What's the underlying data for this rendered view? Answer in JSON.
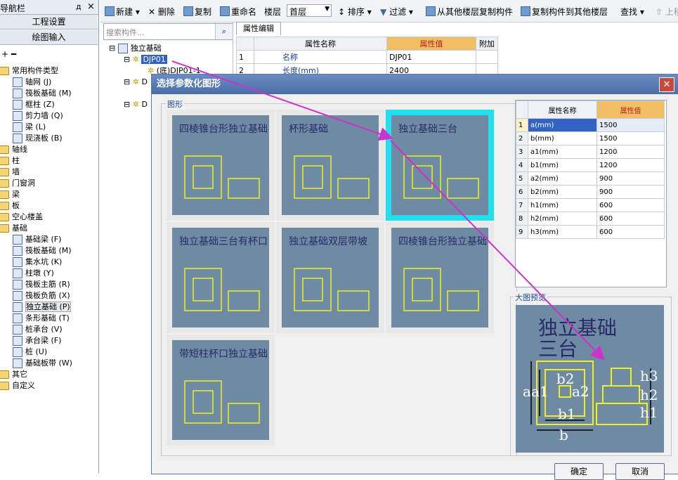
{
  "nav": {
    "title": "导航栏",
    "pin": "д",
    "close": "×",
    "btn_project": "工程设置",
    "btn_draw": "绘图输入",
    "tree": [
      {
        "label": "常用构件类型",
        "level": 0,
        "folder": true,
        "open": true
      },
      {
        "label": "轴网 (J)",
        "level": 1
      },
      {
        "label": "筏板基础 (M)",
        "level": 1
      },
      {
        "label": "框柱 (Z)",
        "level": 1
      },
      {
        "label": "剪力墙 (Q)",
        "level": 1
      },
      {
        "label": "梁 (L)",
        "level": 1
      },
      {
        "label": "现浇板 (B)",
        "level": 1
      },
      {
        "label": "轴线",
        "level": 0,
        "folder": true
      },
      {
        "label": "柱",
        "level": 0,
        "folder": true
      },
      {
        "label": "墙",
        "level": 0,
        "folder": true
      },
      {
        "label": "门窗洞",
        "level": 0,
        "folder": true
      },
      {
        "label": "梁",
        "level": 0,
        "folder": true
      },
      {
        "label": "板",
        "level": 0,
        "folder": true
      },
      {
        "label": "空心楼盖",
        "level": 0,
        "folder": true
      },
      {
        "label": "基础",
        "level": 0,
        "folder": true,
        "open": true
      },
      {
        "label": "基础梁 (F)",
        "level": 1
      },
      {
        "label": "筏板基础 (M)",
        "level": 1
      },
      {
        "label": "集水坑 (K)",
        "level": 1
      },
      {
        "label": "柱墩 (Y)",
        "level": 1
      },
      {
        "label": "筏板主筋 (R)",
        "level": 1
      },
      {
        "label": "筏板负筋 (X)",
        "level": 1
      },
      {
        "label": "独立基础 (P)",
        "level": 1,
        "selected": true
      },
      {
        "label": "条形基础 (T)",
        "level": 1
      },
      {
        "label": "桩承台 (V)",
        "level": 1
      },
      {
        "label": "承台梁 (F)",
        "level": 1
      },
      {
        "label": "桩 (U)",
        "level": 1
      },
      {
        "label": "基础板带 (W)",
        "level": 1
      },
      {
        "label": "其它",
        "level": 0,
        "folder": true
      },
      {
        "label": "自定义",
        "level": 0,
        "folder": true
      }
    ]
  },
  "toolbar": {
    "new": "新建",
    "delete": "删除",
    "copy": "复制",
    "rename": "重命名",
    "floor_label": "楼层",
    "floor_value": "首层",
    "sort": "排序",
    "filter": "过滤",
    "copy_from": "从其他楼层复制构件",
    "copy_to": "复制构件到其他楼层",
    "find": "查找",
    "more": "上移"
  },
  "search": {
    "placeholder": "搜索构件..."
  },
  "comptree": {
    "root": "独立基础",
    "item1": "DJP01",
    "item1_child": "(底)DJP01-1",
    "item2": "D",
    "item3": "D"
  },
  "props": {
    "tab": "属性编辑",
    "col_name": "属性名称",
    "col_value": "属性值",
    "col_extra": "附加",
    "rows": [
      {
        "idx": "1",
        "name": "名称",
        "value": "DJP01"
      },
      {
        "idx": "2",
        "name": "长度(mm)",
        "value": "2400"
      }
    ]
  },
  "dialog": {
    "title": "选择参数化图形",
    "group_label": "图形",
    "preview_label": "大图预览",
    "ok": "确定",
    "cancel": "取消",
    "cards": [
      {
        "title": "四棱锥台形独立基础"
      },
      {
        "title": "杯形基础"
      },
      {
        "title": "独立基础三台",
        "selected": true
      },
      {
        "title": "独立基础三台有杯口"
      },
      {
        "title": "独立基础双层带坡"
      },
      {
        "title": "四棱锥台形独立基础带柱"
      },
      {
        "title": "带短柱杯口独立基础"
      }
    ],
    "params": {
      "col_name": "属性名称",
      "col_value": "属性值",
      "rows": [
        {
          "idx": "1",
          "name": "a(mm)",
          "value": "1500"
        },
        {
          "idx": "2",
          "name": "b(mm)",
          "value": "1500"
        },
        {
          "idx": "3",
          "name": "a1(mm)",
          "value": "1200"
        },
        {
          "idx": "4",
          "name": "b1(mm)",
          "value": "1200"
        },
        {
          "idx": "5",
          "name": "a2(mm)",
          "value": "900"
        },
        {
          "idx": "6",
          "name": "b2(mm)",
          "value": "900"
        },
        {
          "idx": "7",
          "name": "h1(mm)",
          "value": "600"
        },
        {
          "idx": "8",
          "name": "h2(mm)",
          "value": "600"
        },
        {
          "idx": "9",
          "name": "h3(mm)",
          "value": "600"
        }
      ]
    }
  },
  "colors": {
    "accent": "#1a4ea0",
    "selected_card": "#20e0f0",
    "diagram_bg": "#6f8aa3",
    "diagram_line": "#f0f020",
    "arrow": "#cc33cc",
    "header_orange": "#f2be64"
  }
}
